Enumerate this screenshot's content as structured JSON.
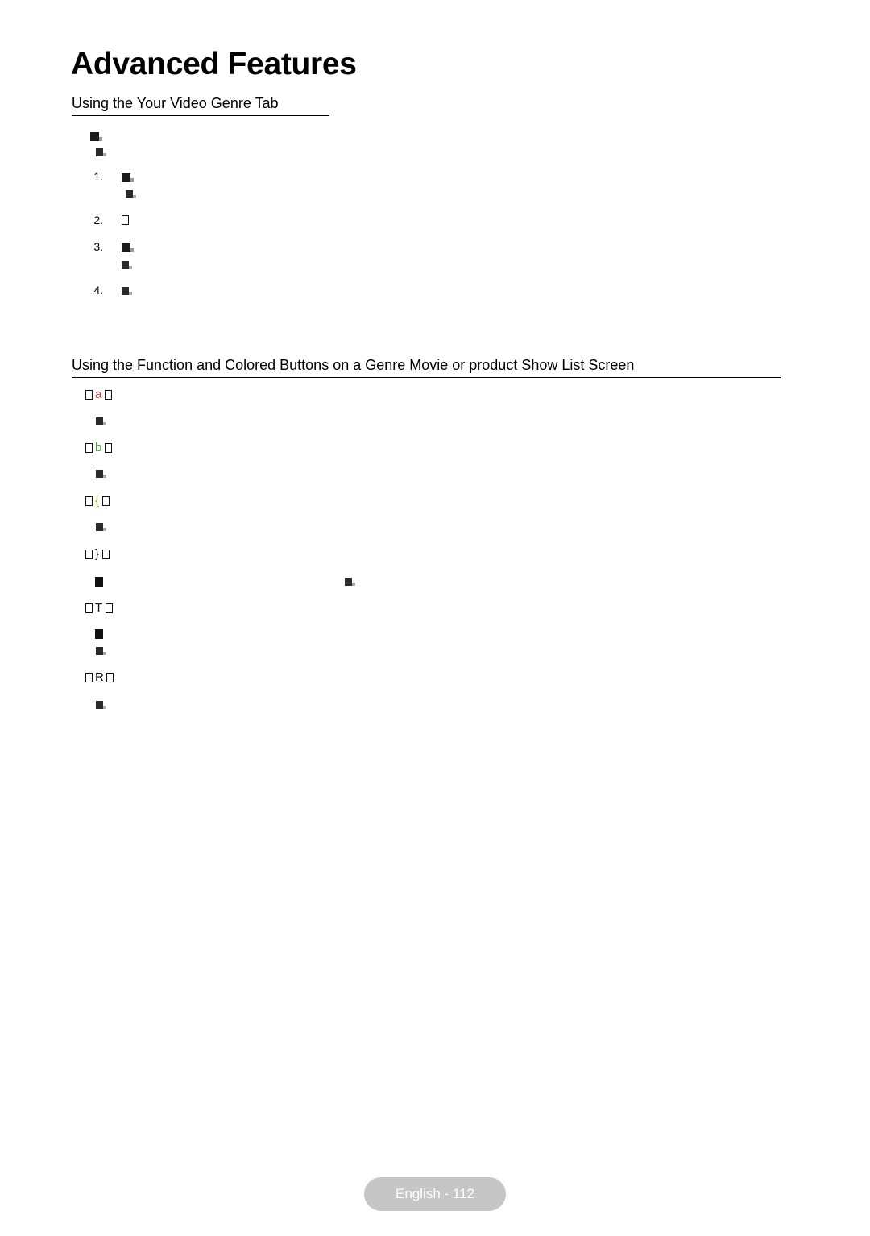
{
  "document": {
    "title": "Advanced Features",
    "sections": [
      {
        "heading": "Using the Your Video Genre Tab",
        "intro_glyphs": [
          "box-dark",
          "box-small"
        ],
        "steps": [
          {
            "number": "1.",
            "glyphs": [
              "box-dark",
              "box-small"
            ]
          },
          {
            "number": "2.",
            "glyphs": [
              "box-hollow"
            ]
          },
          {
            "number": "3.",
            "glyphs": [
              "box-dark",
              "box-small"
            ]
          },
          {
            "number": "4.",
            "glyphs": [
              "box-small"
            ]
          }
        ]
      },
      {
        "heading": "Using the Function and Colored Buttons on a Genre Movie or product Show List Screen",
        "entries": [
          {
            "key": "a",
            "key_color": "#e8403a",
            "body_glyphs": [
              "box-small"
            ]
          },
          {
            "key": "b",
            "key_color": "#3fa13a",
            "body_glyphs": [
              "box-small"
            ]
          },
          {
            "key": "{",
            "key_color": "#b7a21e",
            "body_glyphs": [
              "box-small"
            ]
          },
          {
            "key": "}",
            "key_color": "#111111",
            "body_glyphs": [
              "box-solid",
              "box-small"
            ]
          },
          {
            "key": "T",
            "key_color": "#111111",
            "body_glyphs": [
              "box-solid",
              "box-small"
            ]
          },
          {
            "key": "R",
            "key_color": "#111111",
            "body_glyphs": [
              "box-small"
            ]
          }
        ]
      }
    ]
  },
  "footer": {
    "label": "English - 112"
  }
}
